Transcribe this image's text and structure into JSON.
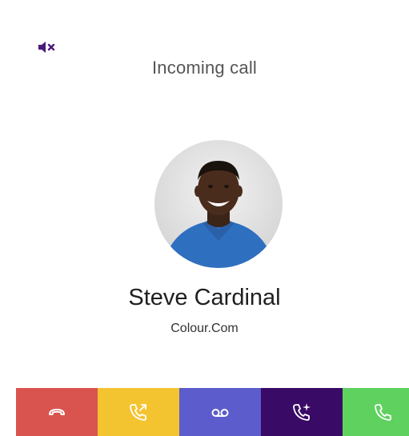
{
  "header": {
    "title": "Incoming call",
    "mute_icon": "speaker-mute-icon"
  },
  "caller": {
    "name": "Steve Cardinal",
    "organization": "Colour.Com",
    "avatar_icon": "caller-photo"
  },
  "actions": [
    {
      "id": "decline",
      "icon": "hang-up-icon",
      "color": "#d9534f"
    },
    {
      "id": "forward",
      "icon": "call-forward-icon",
      "color": "#f4c430"
    },
    {
      "id": "voicemail",
      "icon": "voicemail-icon",
      "color": "#5c5ccc"
    },
    {
      "id": "smart-answer",
      "icon": "call-sparkle-icon",
      "color": "#3a0a67"
    },
    {
      "id": "accept",
      "icon": "phone-answer-icon",
      "color": "#5fd15f"
    }
  ],
  "colors": {
    "accent": "#4b1a7a",
    "title_text": "#555555"
  }
}
